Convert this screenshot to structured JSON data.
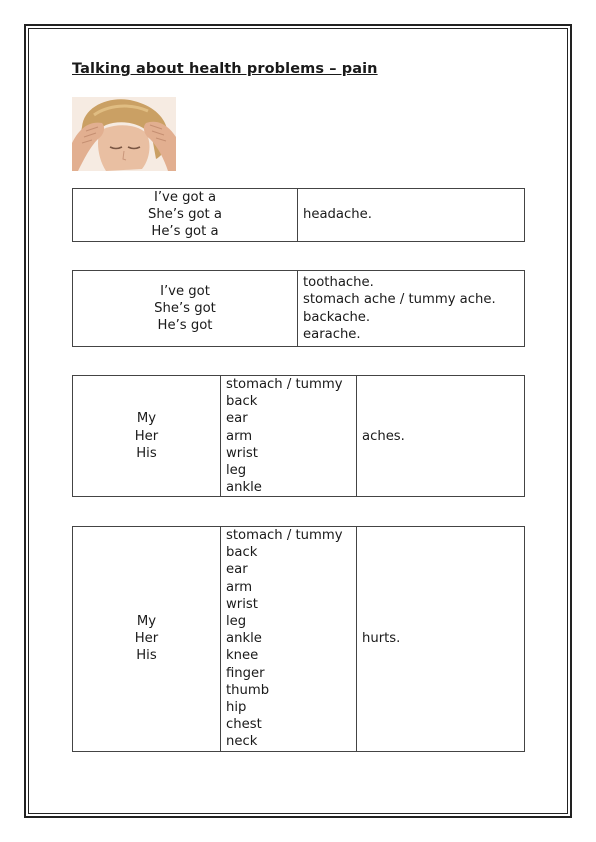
{
  "title": "Talking about health problems – pain",
  "photo_icon": "headache-woman-photo",
  "table1": {
    "subjects": [
      "I’ve got a",
      "She’s got a",
      "He’s got a"
    ],
    "complement": "headache."
  },
  "table2": {
    "subjects": [
      "I’ve got",
      "She’s got",
      "He’s got"
    ],
    "complements": [
      "toothache.",
      "stomach ache / tummy ache.",
      "backache.",
      "earache."
    ]
  },
  "table3": {
    "possessives": [
      "My",
      "Her",
      "His"
    ],
    "body_parts": [
      "stomach / tummy",
      "back",
      "ear",
      "arm",
      "wrist",
      "leg",
      "ankle"
    ],
    "verb": "aches."
  },
  "table4": {
    "possessives": [
      "My",
      "Her",
      "His"
    ],
    "body_parts": [
      "stomach / tummy",
      "back",
      "ear",
      "arm",
      "wrist",
      "leg",
      "ankle",
      "knee",
      "finger",
      "thumb",
      "hip",
      "chest",
      "neck"
    ],
    "verb": "hurts."
  }
}
